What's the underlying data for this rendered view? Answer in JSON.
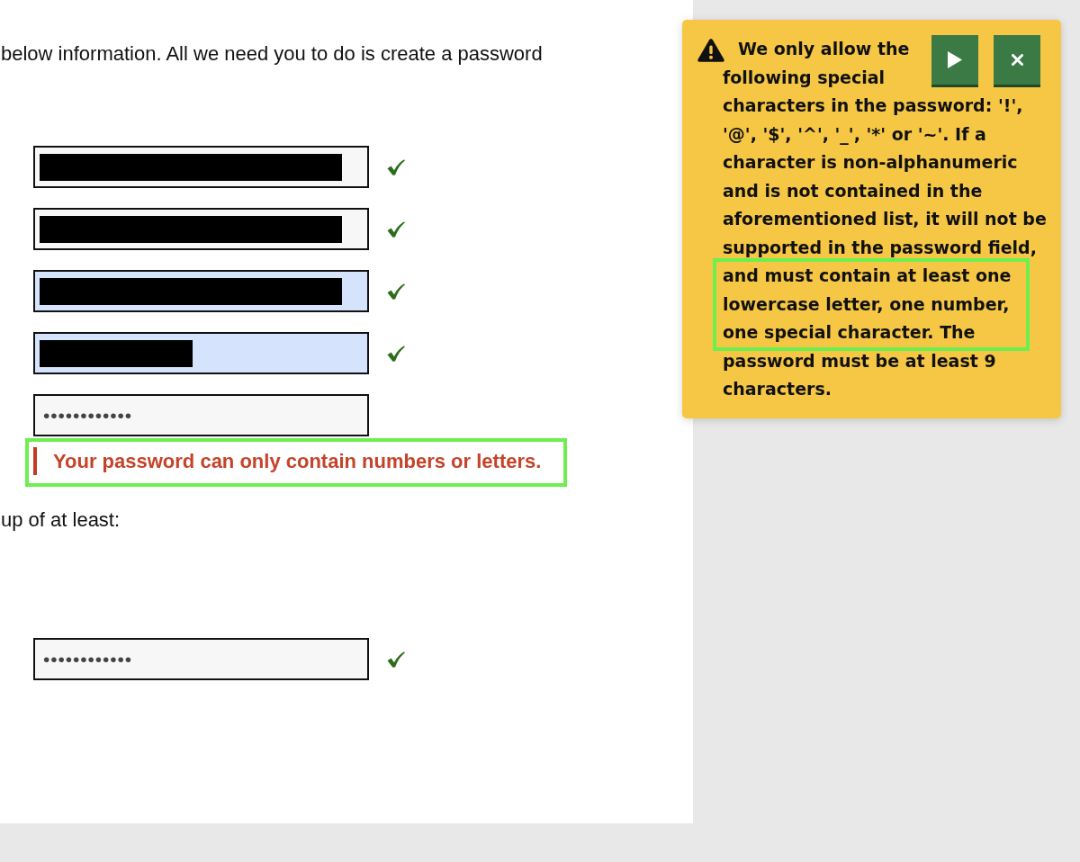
{
  "intro_text": "below information. All we need you to do is create a password",
  "fields": [
    {
      "kind": "redacted",
      "autofilled": false,
      "valid": true
    },
    {
      "kind": "redacted",
      "autofilled": false,
      "valid": true
    },
    {
      "kind": "redacted",
      "autofilled": true,
      "valid": true
    },
    {
      "kind": "partial",
      "autofilled": true,
      "valid": true
    },
    {
      "kind": "password",
      "value": "••••••••••••",
      "autofilled": false,
      "valid": false
    }
  ],
  "error_message": {
    "text": "Your password can only contain numbers or letters.",
    "highlighted": true
  },
  "requirements_text": "up of at least:",
  "confirm_field": {
    "kind": "password",
    "value": "••••••••••••",
    "autofilled": false,
    "valid": true
  },
  "tooltip": {
    "heading": "We only allow the following special",
    "buttons": [
      {
        "kind": "play"
      },
      {
        "kind": "close"
      }
    ],
    "segments": [
      {
        "text": "characters in the password: '!', '@', '$', '^', '_', '*' or '~'. If a character is non-alphanumeric and is not contained in the aforementioned list, it will not be supported in the password field,",
        "highlighted": false
      },
      {
        "text": "and must contain at least one lowercase letter, one number, one special character. The",
        "highlighted": true
      },
      {
        "text": "password must be at least 9 characters.",
        "highlighted": false
      }
    ]
  }
}
